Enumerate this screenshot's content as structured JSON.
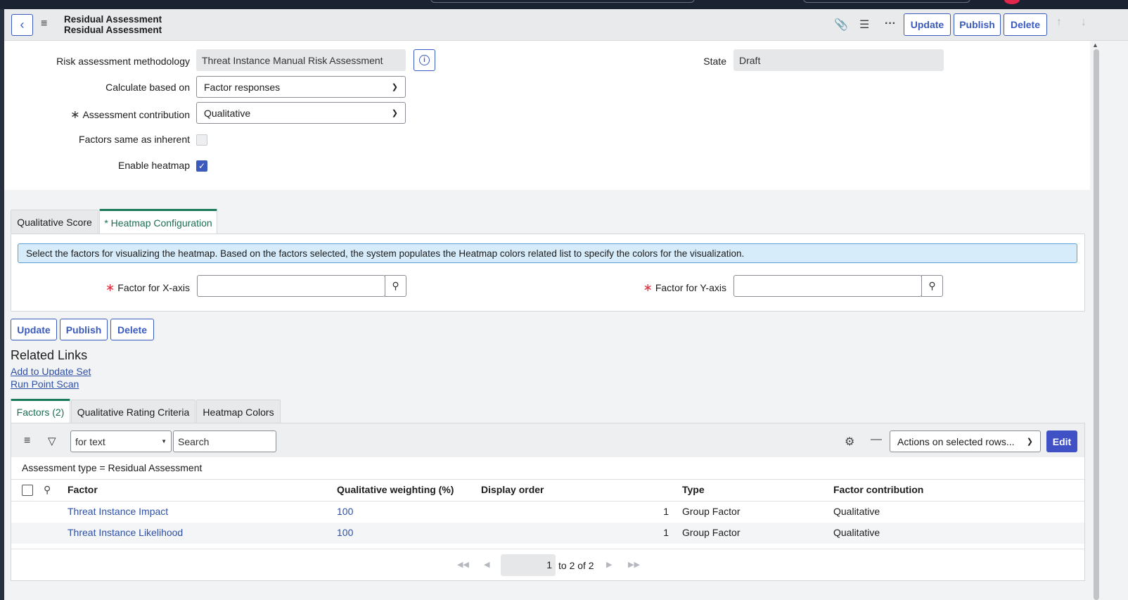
{
  "header": {
    "title_line1": "Residual Assessment",
    "title_line2": "Residual Assessment",
    "buttons": {
      "update": "Update",
      "publish": "Publish",
      "delete": "Delete"
    }
  },
  "form": {
    "methodology_label": "Risk assessment methodology",
    "methodology_value": "Threat Instance Manual Risk Assessment",
    "state_label": "State",
    "state_value": "Draft",
    "calculate_label": "Calculate based on",
    "calculate_value": "Factor responses",
    "contribution_label": "Assessment contribution",
    "contribution_value": "Qualitative",
    "factors_same_label": "Factors same as inherent",
    "factors_same_checked": false,
    "enable_heatmap_label": "Enable heatmap",
    "enable_heatmap_checked": true
  },
  "section_tabs": [
    {
      "label": "Qualitative Score",
      "active": false
    },
    {
      "label": "* Heatmap Configuration",
      "active": true
    }
  ],
  "heatmap": {
    "info": "Select the factors for visualizing the heatmap. Based on the factors selected, the system populates the Heatmap colors related list to specify the colors for the visualization.",
    "x_label": "Factor for X-axis",
    "x_value": "",
    "y_label": "Factor for Y-axis",
    "y_value": ""
  },
  "bottom_buttons": {
    "update": "Update",
    "publish": "Publish",
    "delete": "Delete"
  },
  "related_links": {
    "heading": "Related Links",
    "items": [
      "Add to Update Set",
      "Run Point Scan"
    ]
  },
  "list_tabs": [
    {
      "label": "Factors (2)",
      "active": true
    },
    {
      "label": "Qualitative Rating Criteria",
      "active": false
    },
    {
      "label": "Heatmap Colors",
      "active": false
    }
  ],
  "list": {
    "search_field": "for text",
    "search_placeholder": "Search",
    "actions": "Actions on selected rows...",
    "edit": "Edit",
    "breadcrumb": "Assessment type = Residual Assessment",
    "columns": [
      "Factor",
      "Qualitative weighting (%)",
      "Display order",
      "Type",
      "Factor contribution"
    ],
    "rows": [
      {
        "factor": "Threat Instance Impact",
        "weighting": "100",
        "order": "1",
        "type": "Group Factor",
        "contribution": "Qualitative"
      },
      {
        "factor": "Threat Instance Likelihood",
        "weighting": "100",
        "order": "1",
        "type": "Group Factor",
        "contribution": "Qualitative"
      }
    ],
    "pager": {
      "current": "1",
      "range": "to 2 of 2"
    }
  },
  "colors": {
    "accent": "#3a5bbd",
    "tab_active": "#1a7a58",
    "info_bg": "#d6ecfb",
    "edit_bg": "#3f51c4"
  }
}
